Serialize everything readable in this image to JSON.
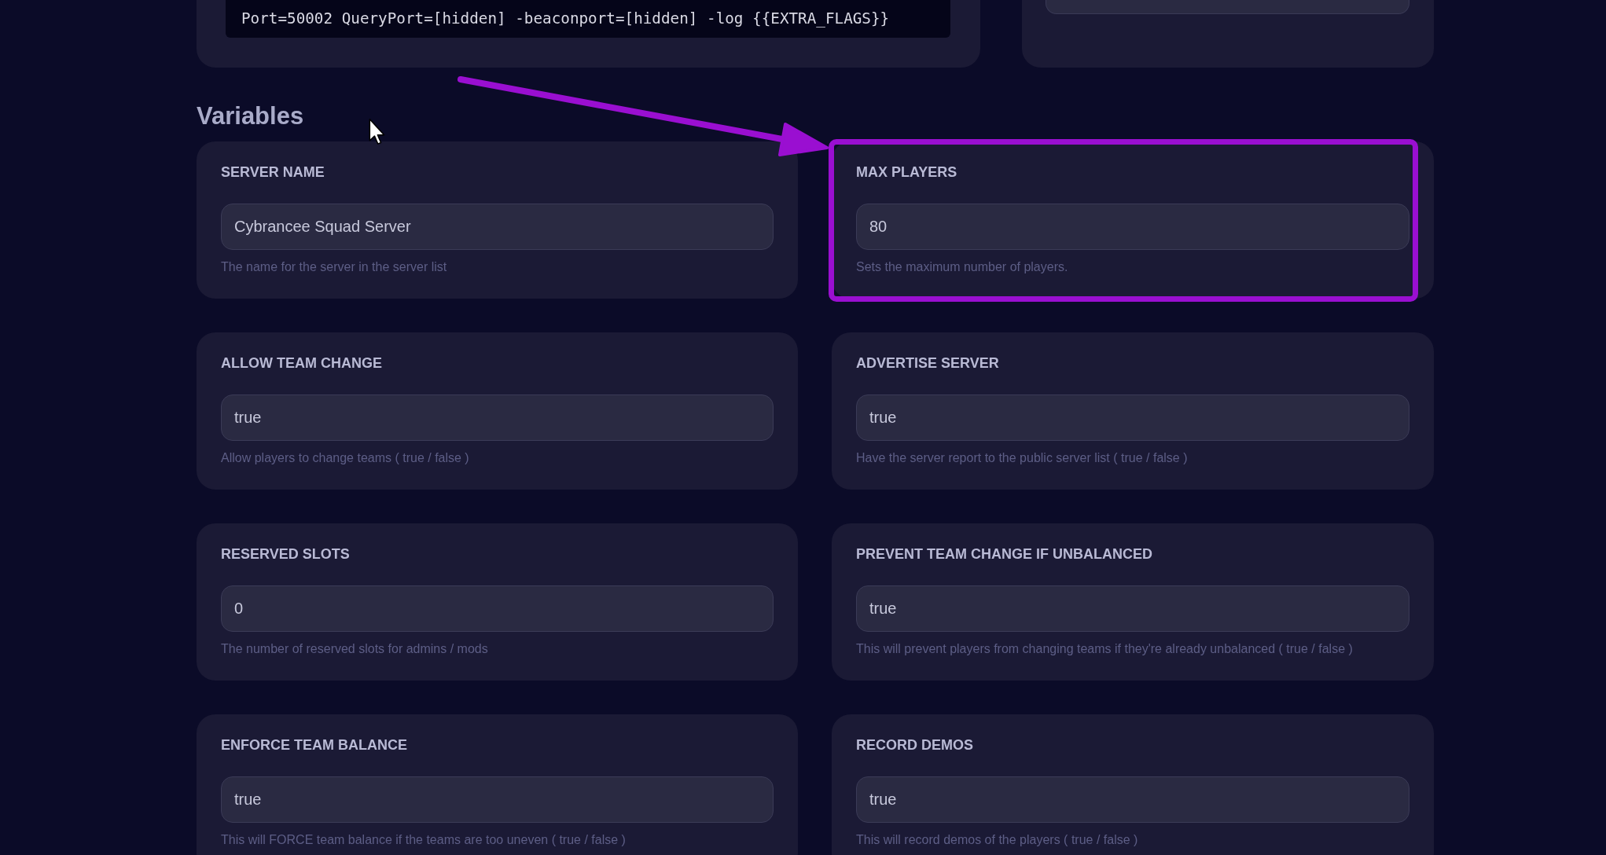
{
  "startup": {
    "command_lines": [
      "Port=50002 QueryPort=[hidden] -beaconport=[hidden] -log {{EXTRA_FLAGS}}"
    ]
  },
  "variables_section": {
    "title": "Variables"
  },
  "variables": [
    {
      "label": "SERVER NAME",
      "value": "Cybrancee Squad Server",
      "description": "The name for the server in the server list",
      "highlighted": false
    },
    {
      "label": "MAX PLAYERS",
      "value": "80",
      "description": "Sets the maximum number of players.",
      "highlighted": true
    },
    {
      "label": "ALLOW TEAM CHANGE",
      "value": "true",
      "description": "Allow players to change teams ( true / false )",
      "highlighted": false
    },
    {
      "label": "ADVERTISE SERVER",
      "value": "true",
      "description": "Have the server report to the public server list ( true / false )",
      "highlighted": false
    },
    {
      "label": "RESERVED SLOTS",
      "value": "0",
      "description": "The number of reserved slots for admins / mods",
      "highlighted": false
    },
    {
      "label": "PREVENT TEAM CHANGE IF UNBALANCED",
      "value": "true",
      "description": "This will prevent players from changing teams if they're already unbalanced ( true / false )",
      "highlighted": false
    },
    {
      "label": "ENFORCE TEAM BALANCE",
      "value": "true",
      "description": "This will FORCE team balance if the teams are too uneven ( true / false )",
      "highlighted": false
    },
    {
      "label": "RECORD DEMOS",
      "value": "true",
      "description": "This will record demos of the players ( true / false )",
      "highlighted": false
    }
  ]
}
